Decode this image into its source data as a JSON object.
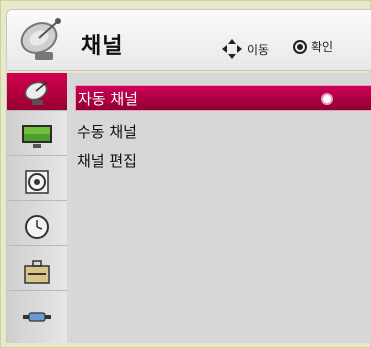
{
  "header": {
    "title": "채널",
    "hint_move": "이동",
    "hint_ok": "확인",
    "icon": "satellite-dish-icon"
  },
  "sidebar": {
    "items": [
      {
        "name": "channel",
        "icon": "satellite-dish-icon",
        "active": true
      },
      {
        "name": "picture",
        "icon": "monitor-icon",
        "active": false
      },
      {
        "name": "audio",
        "icon": "speaker-icon",
        "active": false
      },
      {
        "name": "time",
        "icon": "clock-icon",
        "active": false
      },
      {
        "name": "options",
        "icon": "toolbox-icon",
        "active": false
      },
      {
        "name": "input",
        "icon": "cable-icon",
        "active": false
      }
    ]
  },
  "menu": {
    "items": [
      {
        "label": "자동 채널",
        "selected": true
      },
      {
        "label": "수동 채널",
        "selected": false
      },
      {
        "label": "채널 편집",
        "selected": false
      }
    ]
  },
  "colors": {
    "accent": "#c8004f",
    "background": "#e8e9c8",
    "panel": "#d7d7d7"
  }
}
